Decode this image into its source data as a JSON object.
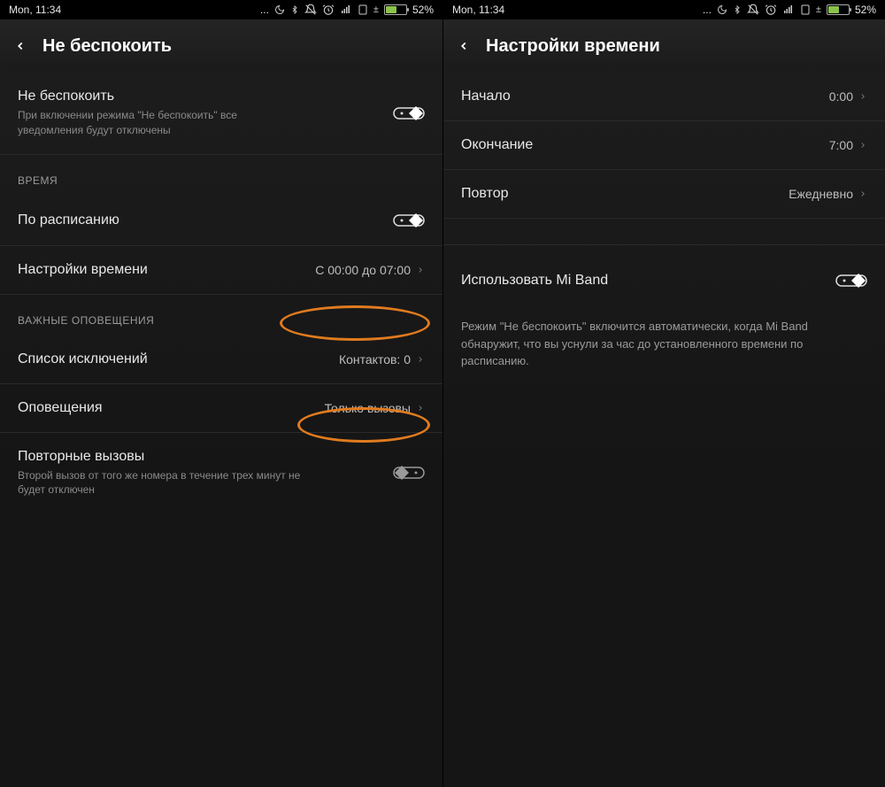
{
  "status": {
    "time": "Mon, 11:34",
    "battery_text": "52%"
  },
  "left": {
    "title": "Не беспокоить",
    "dnd": {
      "label": "Не беспокоить",
      "sub": "При включении режима \"Не беспокоить\" все уведомления будут отключены"
    },
    "section_time": "ВРЕМЯ",
    "schedule_label": "По расписанию",
    "time_settings": {
      "label": "Настройки времени",
      "value": "С 00:00 до 07:00"
    },
    "section_alerts": "ВАЖНЫЕ ОПОВЕЩЕНИЯ",
    "exceptions": {
      "label": "Список исключений",
      "value": "Контактов: 0"
    },
    "alerts": {
      "label": "Оповещения",
      "value": "Только вызовы"
    },
    "repeat_calls": {
      "label": "Повторные вызовы",
      "sub": "Второй вызов от того же номера в течение трех минут не будет отключен"
    }
  },
  "right": {
    "title": "Настройки времени",
    "start": {
      "label": "Начало",
      "value": "0:00"
    },
    "end": {
      "label": "Окончание",
      "value": "7:00"
    },
    "repeat": {
      "label": "Повтор",
      "value": "Ежедневно"
    },
    "miband_label": "Использовать Mi Band",
    "miband_hint": "Режим \"Не беспокоить\" включится автоматически, когда Mi Band обнаружит, что вы уснули за час до установленного времени по расписанию."
  }
}
